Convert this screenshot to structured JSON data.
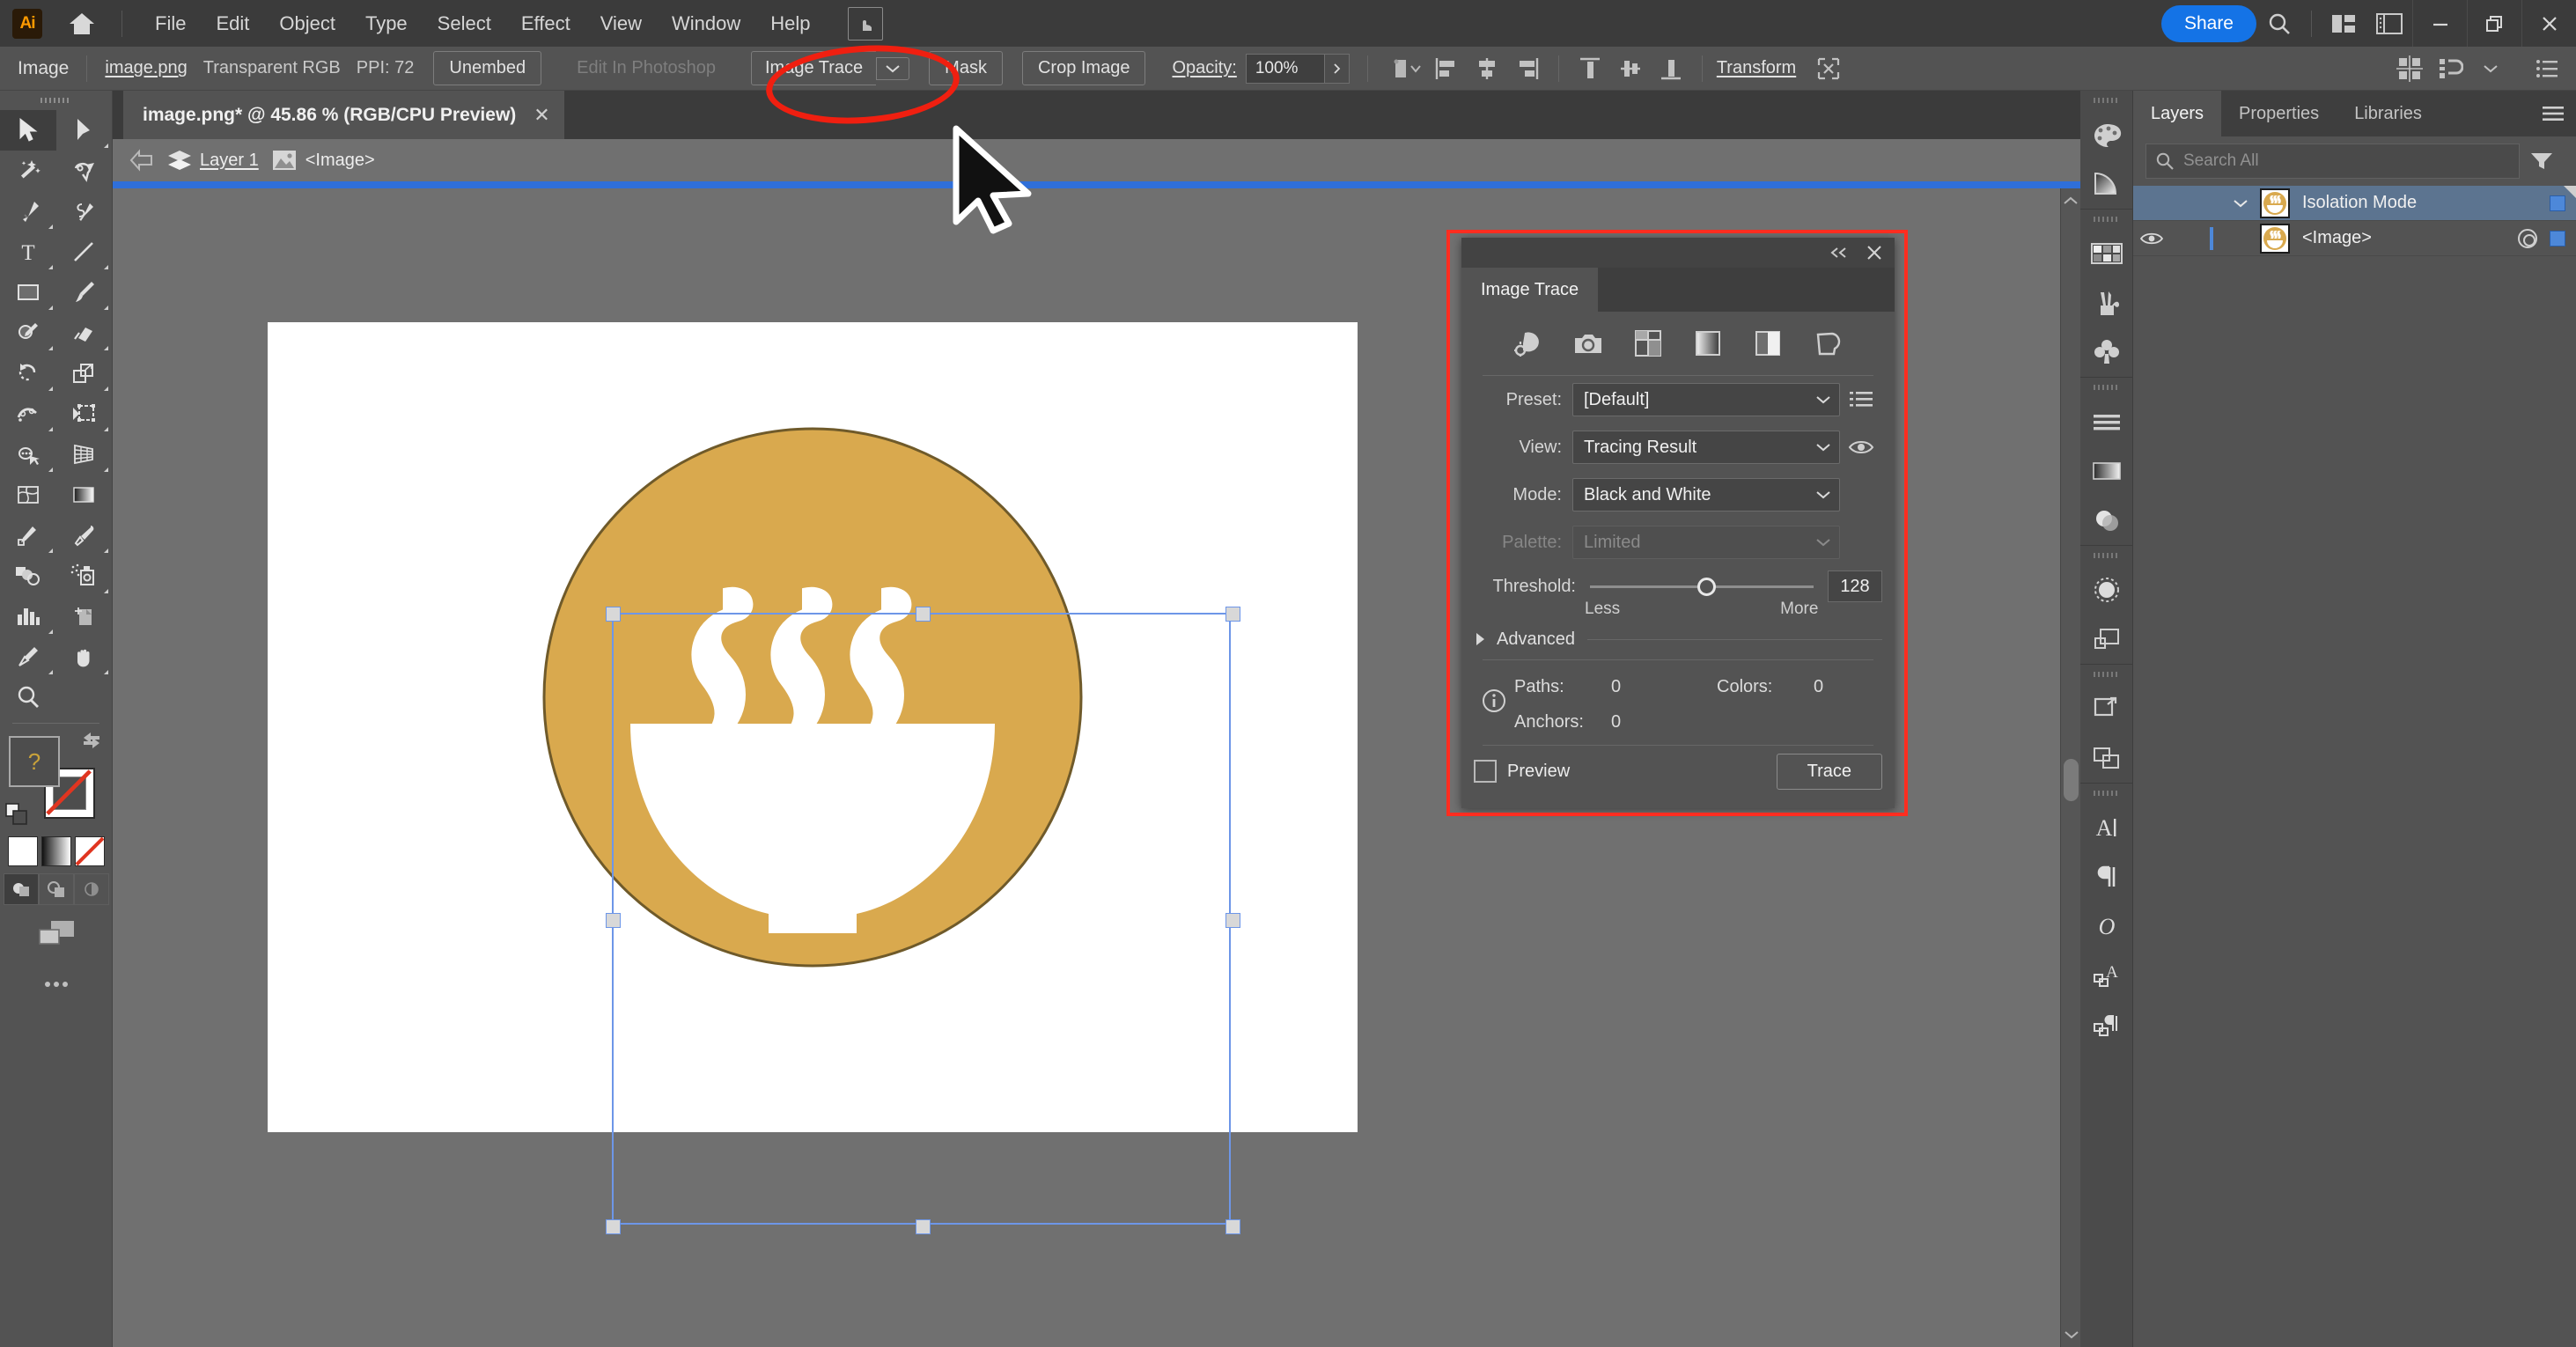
{
  "app": {
    "logo_text": "Ai",
    "home_icon": "home-icon",
    "touch_icon": "touch-workspace-icon"
  },
  "menubar": {
    "items": [
      "File",
      "Edit",
      "Object",
      "Type",
      "Select",
      "Effect",
      "View",
      "Window",
      "Help"
    ],
    "share_label": "Share",
    "search_icon": "search-icon",
    "arrange_icon": "arrange-documents-icon",
    "panel_icon": "panel-toggle-icon",
    "minimize_icon": "minimize-icon",
    "restore_icon": "restore-icon",
    "close_icon": "close-icon"
  },
  "controlbar": {
    "object_type": "Image",
    "file_name": "image.png",
    "color_mode": "Transparent RGB",
    "ppi": "PPI: 72",
    "unembed_label": "Unembed",
    "edit_in_photoshop_label": "Edit In Photoshop",
    "image_trace_label": "Image Trace",
    "image_trace_caret": "chevron-down-icon",
    "mask_label": "Mask",
    "crop_image_label": "Crop Image",
    "opacity_label": "Opacity:",
    "opacity_value": "100%",
    "opacity_more_icon": "chevron-right-icon",
    "recolor_icon": "recolor-artwork-icon",
    "align_left_icon": "align-left-icon",
    "align_center_h_icon": "align-center-horizontal-icon",
    "align_right_icon": "align-right-icon",
    "align_top_icon": "align-top-icon",
    "align_center_v_icon": "align-center-vertical-icon",
    "align_bottom_icon": "align-bottom-icon",
    "transform_label": "Transform",
    "isolate_icon": "isolate-selected-object-icon",
    "artboards_icon": "artboards-icon",
    "snap_icon": "snap-to-glyph-icon",
    "options_icon": "more-options-icon"
  },
  "toolbar": {
    "grip_icon": "panel-grip-icon",
    "tools": [
      {
        "name": "selection-tool",
        "icon": "arrow-solid-icon",
        "active": true,
        "corner": false
      },
      {
        "name": "direct-selection-tool",
        "icon": "arrow-white-icon",
        "active": false,
        "corner": true
      },
      {
        "name": "magic-wand-tool",
        "icon": "magic-wand-icon",
        "active": false,
        "corner": false
      },
      {
        "name": "lasso-tool",
        "icon": "lasso-icon",
        "active": false,
        "corner": false
      },
      {
        "name": "pen-tool",
        "icon": "pen-icon",
        "active": false,
        "corner": true
      },
      {
        "name": "curvature-tool",
        "icon": "curvature-icon",
        "active": false,
        "corner": false
      },
      {
        "name": "type-tool",
        "icon": "type-icon",
        "active": false,
        "corner": true
      },
      {
        "name": "line-segment-tool",
        "icon": "line-icon",
        "active": false,
        "corner": true
      },
      {
        "name": "rectangle-tool",
        "icon": "rectangle-icon",
        "active": false,
        "corner": true
      },
      {
        "name": "paintbrush-tool",
        "icon": "paintbrush-icon",
        "active": false,
        "corner": true
      },
      {
        "name": "shaper-tool",
        "icon": "shaper-pencil-icon",
        "active": false,
        "corner": true
      },
      {
        "name": "eraser-tool",
        "icon": "eraser-icon",
        "active": false,
        "corner": true
      },
      {
        "name": "rotate-tool",
        "icon": "rotate-icon",
        "active": false,
        "corner": true
      },
      {
        "name": "scale-tool",
        "icon": "scale-icon",
        "active": false,
        "corner": true
      },
      {
        "name": "width-tool",
        "icon": "width-warp-icon",
        "active": false,
        "corner": true
      },
      {
        "name": "free-transform-tool",
        "icon": "free-transform-icon",
        "active": false,
        "corner": true
      },
      {
        "name": "shape-builder-tool",
        "icon": "shape-builder-icon",
        "active": false,
        "corner": true
      },
      {
        "name": "perspective-grid-tool",
        "icon": "perspective-grid-icon",
        "active": false,
        "corner": true
      },
      {
        "name": "mesh-tool",
        "icon": "mesh-icon",
        "active": false,
        "corner": false
      },
      {
        "name": "gradient-tool",
        "icon": "gradient-icon",
        "active": false,
        "corner": false
      },
      {
        "name": "blend-tool",
        "icon": "blend-icon",
        "active": false,
        "corner": true
      },
      {
        "name": "eyedropper-tool",
        "icon": "eyedropper-icon",
        "active": false,
        "corner": true
      },
      {
        "name": "symbol-sprayer-setup",
        "icon": "symbol-shapes-icon",
        "active": false,
        "corner": false
      },
      {
        "name": "symbol-sprayer-tool",
        "icon": "symbol-sprayer-icon",
        "active": false,
        "corner": true
      },
      {
        "name": "column-graph-tool",
        "icon": "column-graph-icon",
        "active": false,
        "corner": true
      },
      {
        "name": "artboard-tool",
        "icon": "artboard-tool-icon",
        "active": false,
        "corner": false
      },
      {
        "name": "slice-tool",
        "icon": "slice-icon",
        "active": false,
        "corner": true
      },
      {
        "name": "hand-tool",
        "icon": "hand-icon",
        "active": false,
        "corner": true
      },
      {
        "name": "zoom-tool",
        "icon": "magnifier-icon",
        "active": false,
        "corner": false
      }
    ],
    "fill_label": "fill-swatch",
    "fill_question": "?",
    "stroke_label": "stroke-swatch",
    "swap_icon": "swap-fill-stroke-icon",
    "default_icon": "default-fill-stroke-icon",
    "modes": [
      "color-swatch",
      "gradient-swatch",
      "none-swatch"
    ],
    "draw_modes": [
      "draw-normal",
      "draw-behind",
      "draw-inside"
    ],
    "screen_mode_icon": "change-screen-mode-icon",
    "more_tools_icon": "edit-toolbar-dots-icon"
  },
  "document": {
    "tab_title": "image.png* @ 45.86 % (RGB/CPU Preview)",
    "tab_close_icon": "close-icon",
    "breadcrumb": {
      "back_icon": "exit-isolation-arrow-icon",
      "layer_icon": "layers-stack-icon",
      "layer_name": "Layer 1",
      "image_icon": "image-thumbnail-icon",
      "object_name": "<Image>"
    },
    "isolation_bar_color": "#2f6fd9",
    "artwork": {
      "name": "steaming-bowl-icon",
      "circle_color": "#d9a94e",
      "circle_stroke": "#6f5a2a",
      "bowl_color": "#ffffff",
      "steam_count": 3
    },
    "selection": {
      "handle_color": "#d8d8d8",
      "border_color": "#6d96e8"
    }
  },
  "image_trace_panel": {
    "collapse_icon": "collapse-panel-icon",
    "close_icon": "close-icon",
    "tab_label": "Image Trace",
    "preset_icons": [
      "auto-color-icon",
      "high-color-icon",
      "low-color-icon",
      "grayscale-icon",
      "black-and-white-icon",
      "outline-icon"
    ],
    "preset_label": "Preset:",
    "preset_value": "[Default]",
    "preset_menu_icon": "preset-menu-icon",
    "view_label": "View:",
    "view_value": "Tracing Result",
    "view_eye_icon": "eye-icon",
    "mode_label": "Mode:",
    "mode_value": "Black and White",
    "palette_label": "Palette:",
    "palette_value": "Limited",
    "threshold_label": "Threshold:",
    "threshold_value": "128",
    "threshold_less": "Less",
    "threshold_more": "More",
    "advanced_label": "Advanced",
    "advanced_arrow": "triangle-right-icon",
    "info_icon": "info-circle-icon",
    "paths_label": "Paths:",
    "paths_value": "0",
    "colors_label": "Colors:",
    "colors_value": "0",
    "anchors_label": "Anchors:",
    "anchors_value": "0",
    "preview_label": "Preview",
    "preview_checked": false,
    "trace_label": "Trace",
    "highlight_color": "#ff2d20"
  },
  "dockbar": {
    "groups": [
      [
        "color-panel-icon",
        "color-guide-icon"
      ],
      [
        "swatches-panel-icon",
        "brushes-panel-icon",
        "symbols-panel-icon"
      ],
      [
        "stroke-panel-icon",
        "gradient-panel-icon",
        "transparency-panel-icon"
      ],
      [
        "appearance-panel-icon",
        "graphic-styles-panel-icon"
      ],
      [
        "transform-panel-icon",
        "pathfinder-panel-icon"
      ],
      [
        "character-panel-icon",
        "paragraph-panel-icon",
        "glyphs-panel-icon",
        "character-styles-panel-icon",
        "paragraph-styles-panel-icon"
      ]
    ]
  },
  "layers_panel": {
    "tabs": [
      {
        "label": "Layers",
        "active": true
      },
      {
        "label": "Properties",
        "active": false
      },
      {
        "label": "Libraries",
        "active": false
      }
    ],
    "menu_icon": "panel-menu-icon",
    "search_icon": "search-icon",
    "search_placeholder": "Search All",
    "filter_icon": "filter-icon",
    "rows": [
      {
        "name": "Isolation Mode",
        "selected": true,
        "has_eye": false,
        "has_chevron": true,
        "chevron_icon": "chevron-down-icon",
        "thumbnail": "bowl-thumbnail",
        "has_target": false,
        "select_color": "#4d88d9"
      },
      {
        "name": "<Image>",
        "selected": false,
        "has_eye": true,
        "eye_icon": "eye-icon",
        "has_chevron": false,
        "thumbnail": "bowl-thumbnail",
        "has_target": true,
        "select_color": "#4d88d9"
      }
    ]
  },
  "annotation": {
    "ellipse_color": "#f01f10",
    "cursor_icon": "mouse-pointer-cursor"
  }
}
